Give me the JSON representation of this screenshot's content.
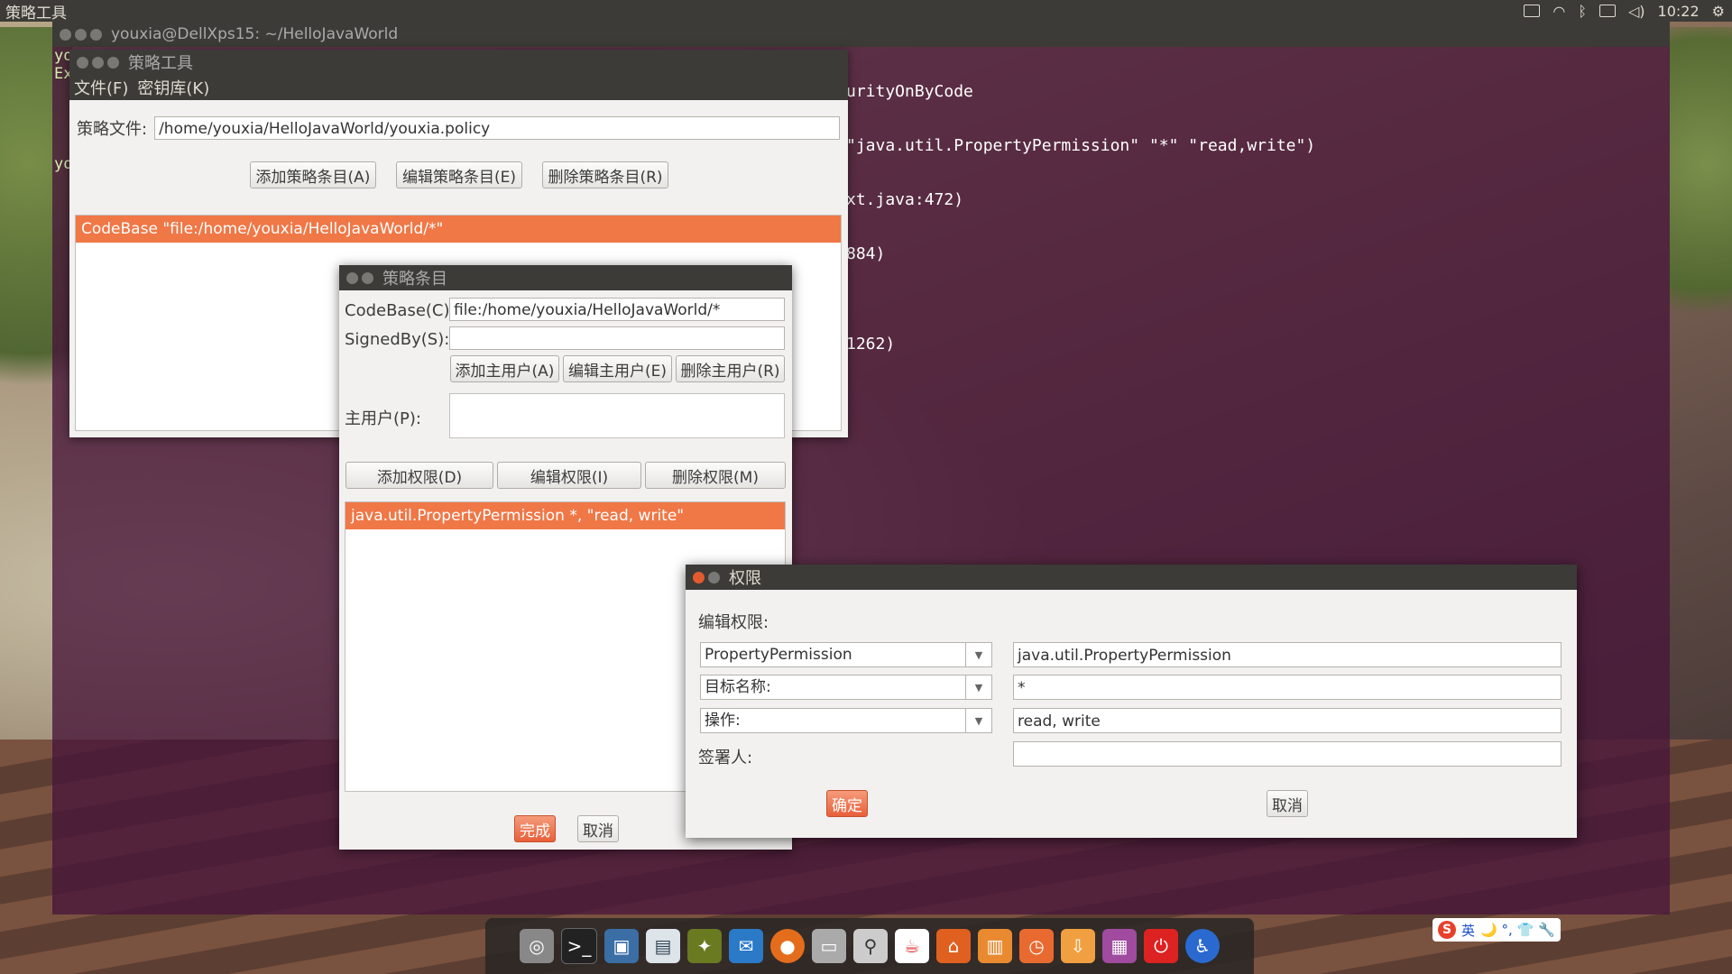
{
  "top_panel": {
    "app_title": "策略工具",
    "clock": "10:22"
  },
  "terminal": {
    "title": "youxia@DellXps15: ~/HelloJavaWorld",
    "left_fragments": [
      "yo",
      "Ex",
      "yo"
    ],
    "lines": [
      "urityOnByCode",
      "\"java.util.PropertyPermission\" \"*\" \"read,write\")",
      "xt.java:472)",
      "884)",
      "",
      "1262)"
    ]
  },
  "policy_tool": {
    "title": "策略工具",
    "menu": [
      "文件(F)",
      "密钥库(K)"
    ],
    "policy_file_label": "策略文件:",
    "policy_file_value": "/home/youxia/HelloJavaWorld/youxia.policy",
    "buttons": {
      "add": "添加策略条目(A)",
      "edit": "编辑策略条目(E)",
      "remove": "删除策略条目(R)"
    },
    "entries": [
      "CodeBase \"file:/home/youxia/HelloJavaWorld/*\""
    ]
  },
  "policy_entry": {
    "title": "策略条目",
    "codebase_label": "CodeBase(C):",
    "codebase_value": "file:/home/youxia/HelloJavaWorld/*",
    "signedby_label": "SignedBy(S):",
    "signedby_value": "",
    "principal_buttons": {
      "add": "添加主用户(A)",
      "edit": "编辑主用户(E)",
      "remove": "删除主用户(R)"
    },
    "principals_label": "主用户(P):",
    "permission_buttons": {
      "add": "添加权限(D)",
      "edit": "编辑权限(I)",
      "remove": "删除权限(M)"
    },
    "permissions": [
      "java.util.PropertyPermission *, \"read, write\""
    ],
    "done": "完成",
    "cancel": "取消"
  },
  "permission_dialog": {
    "title": "权限",
    "heading": "编辑权限:",
    "permission_combo": "PropertyPermission",
    "permission_value": "java.util.PropertyPermission",
    "target_combo": "目标名称:",
    "target_value": "*",
    "action_combo": "操作:",
    "action_value": "read, write",
    "signer_label": "签署人:",
    "signer_value": "",
    "ok": "确定",
    "cancel": "取消"
  },
  "ime": {
    "mode": "英",
    "symbols": "🌙 °, 👕 🔧"
  },
  "colors": {
    "selection": "#f07746",
    "titlebar": "#3c3b37",
    "close": "#e25a2e"
  }
}
